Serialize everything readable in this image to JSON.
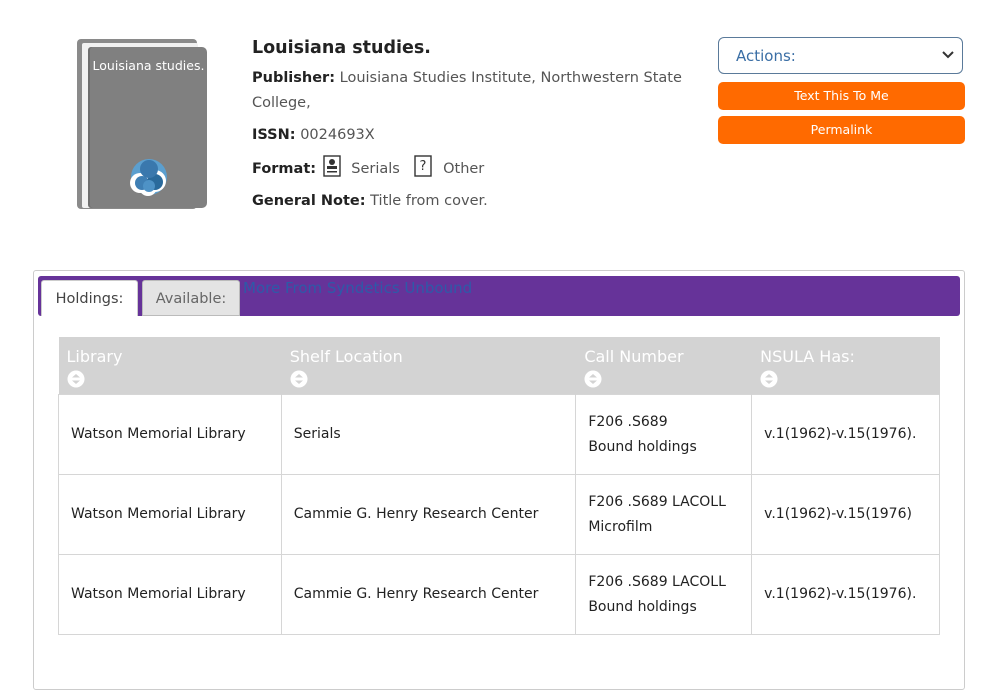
{
  "record": {
    "cover_title": "Louisiana studies.",
    "title": "Louisiana studies.",
    "publisher_label": "Publisher:",
    "publisher": "Louisiana Studies Institute, Northwestern State College,",
    "issn_label": "ISSN:",
    "issn": "0024693X",
    "format_label": "Format:",
    "formats": [
      {
        "label": "Serials",
        "icon": "serial-icon"
      },
      {
        "label": "Other",
        "icon": "question-icon"
      }
    ],
    "note_label": "General Note:",
    "note": "Title from cover."
  },
  "actions": {
    "select_label": "Actions:",
    "text_button": "Text This To Me",
    "permalink_button": "Permalink",
    "accent": "#ff6a00"
  },
  "tabs": {
    "holdings": "Holdings:",
    "available": "Available:",
    "more_link": "More From Syndetics Unbound",
    "bar_color": "#663399"
  },
  "holdings": {
    "headers": [
      "Library",
      "Shelf Location",
      "Call Number",
      "NSULA Has:"
    ],
    "rows": [
      {
        "library": "Watson Memorial Library",
        "shelf": "Serials",
        "call": "F206 .S689",
        "call_note": "Bound holdings",
        "has": "v.1(1962)-v.15(1976)."
      },
      {
        "library": "Watson Memorial Library",
        "shelf": "Cammie G. Henry Research Center",
        "call": "F206 .S689 LACOLL",
        "call_note": "Microfilm",
        "has": "v.1(1962)-v.15(1976)"
      },
      {
        "library": "Watson Memorial Library",
        "shelf": "Cammie G. Henry Research Center",
        "call": "F206 .S689 LACOLL",
        "call_note": "Bound holdings",
        "has": "v.1(1962)-v.15(1976)."
      }
    ]
  }
}
